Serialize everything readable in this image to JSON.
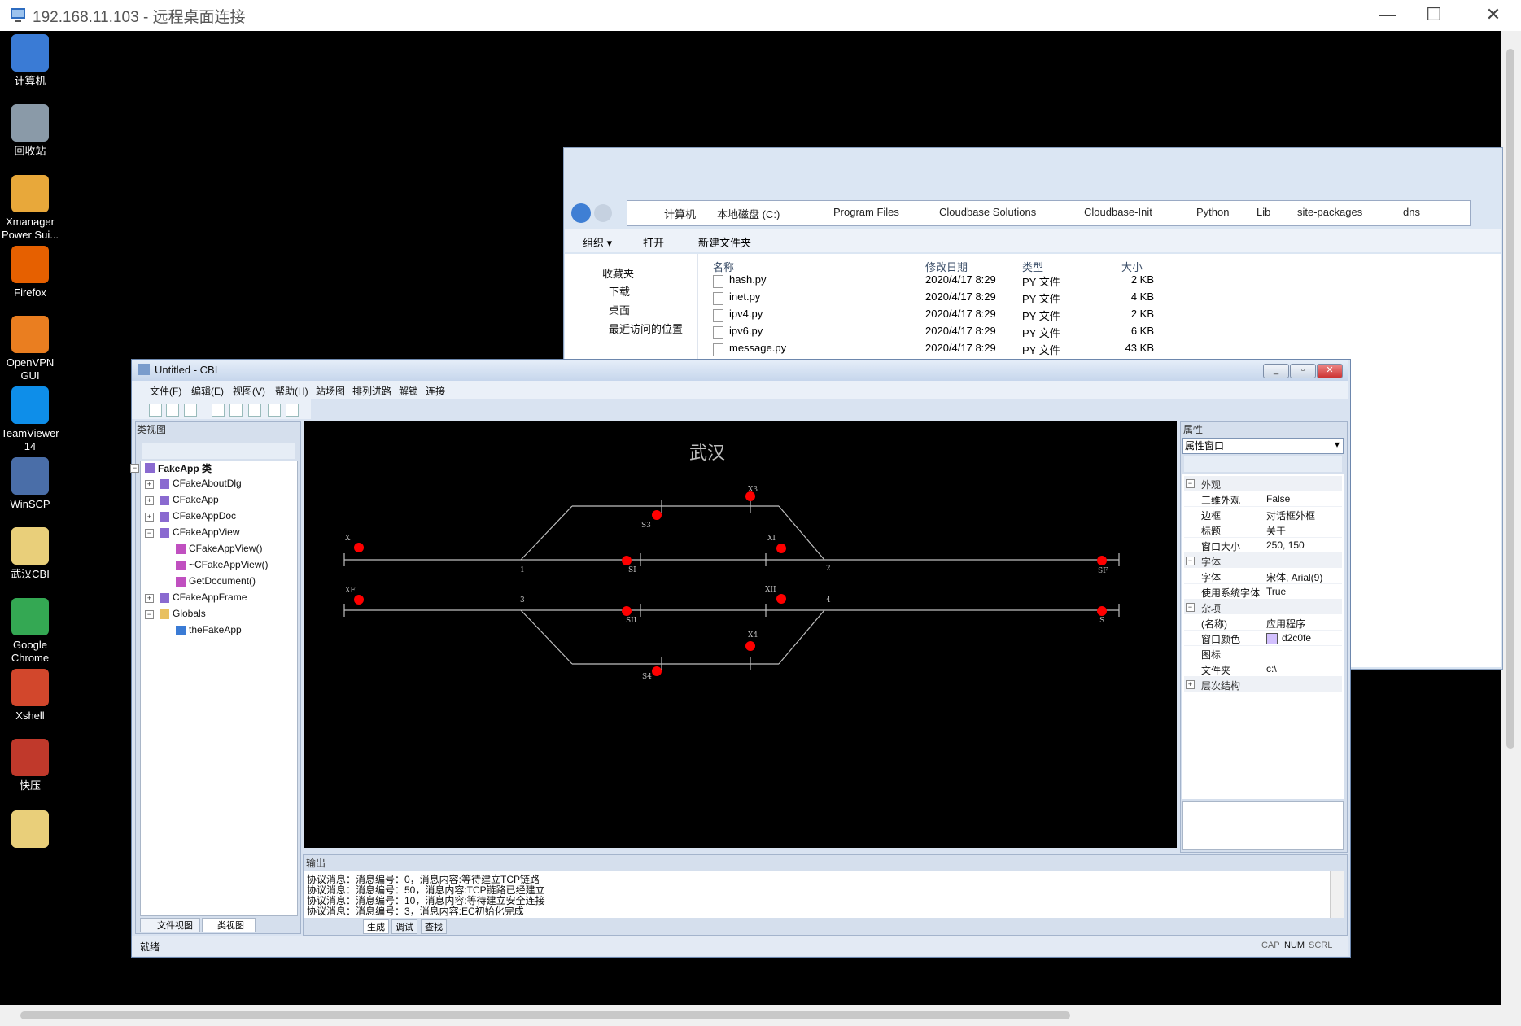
{
  "rdp": {
    "title": "192.168.11.103 - 远程桌面连接",
    "min": "—",
    "max": "☐",
    "close": "✕"
  },
  "desktop": {
    "icons": [
      {
        "label": "计算机",
        "color": "#3a7bd5"
      },
      {
        "label": "回收站",
        "color": "#8a9aa8"
      },
      {
        "label": "Xmanager Power Sui...",
        "color": "#e8a83a"
      },
      {
        "label": "Firefox",
        "color": "#e66000"
      },
      {
        "label": "OpenVPN GUI",
        "color": "#ea7e20"
      },
      {
        "label": "TeamViewer 14",
        "color": "#0e8ee9"
      },
      {
        "label": "WinSCP",
        "color": "#4a6ea8"
      },
      {
        "label": "武汉CBI",
        "color": "#e9cf7a"
      },
      {
        "label": "Google Chrome",
        "color": "#34a853"
      },
      {
        "label": "Xshell",
        "color": "#d2472c"
      },
      {
        "label": "快压",
        "color": "#c0392b"
      },
      {
        "label": "",
        "color": "#e9cf7a"
      }
    ]
  },
  "explorer": {
    "breadcrumb": [
      "计算机",
      "本地磁盘 (C:)",
      "Program Files",
      "Cloudbase Solutions",
      "Cloudbase-Init",
      "Python",
      "Lib",
      "site-packages",
      "dns"
    ],
    "toolbar": {
      "organize": "组织 ▾",
      "open": "打开",
      "new_folder": "新建文件夹"
    },
    "nav": [
      "收藏夹",
      "下载",
      "桌面",
      "最近访问的位置"
    ],
    "columns": {
      "name": "名称",
      "date": "修改日期",
      "type": "类型",
      "size": "大小"
    },
    "files": [
      {
        "name": "hash.py",
        "date": "2020/4/17 8:29",
        "type": "PY 文件",
        "size": "2 KB"
      },
      {
        "name": "inet.py",
        "date": "2020/4/17 8:29",
        "type": "PY 文件",
        "size": "4 KB"
      },
      {
        "name": "ipv4.py",
        "date": "2020/4/17 8:29",
        "type": "PY 文件",
        "size": "2 KB"
      },
      {
        "name": "ipv6.py",
        "date": "2020/4/17 8:29",
        "type": "PY 文件",
        "size": "6 KB"
      },
      {
        "name": "message.py",
        "date": "2020/4/17 8:29",
        "type": "PY 文件",
        "size": "43 KB"
      }
    ]
  },
  "cbi": {
    "title": "Untitled - CBI",
    "menu": [
      "文件(F)",
      "编辑(E)",
      "视图(V)",
      "帮助(H)",
      "站场图",
      "排列进路",
      "解锁",
      "连接"
    ],
    "class_view": {
      "title": "类视图",
      "root": "FakeApp 类",
      "items": [
        "CFakeAboutDlg",
        "CFakeApp",
        "CFakeAppDoc",
        "CFakeAppView",
        "CFakeAppView()",
        "~CFakeAppView()",
        "GetDocument()",
        "CFakeAppFrame",
        "Globals",
        "theFakeApp"
      ],
      "tabs": [
        "文件视图",
        "类视图"
      ]
    },
    "station": {
      "title": "武汉",
      "labels": {
        "X": "X",
        "XF": "XF",
        "S3": "S3",
        "X3": "X3",
        "XI": "XI",
        "XII": "XII",
        "SI": "SI",
        "SII": "SII",
        "X4": "X4",
        "S4": "S4",
        "SF": "SF",
        "S": "S",
        "n1": "1",
        "n2": "2",
        "n3": "3",
        "n4": "4"
      },
      "signal_color": "#ff0000",
      "track_color": "#bfbfbf"
    },
    "properties": {
      "title": "属性",
      "combo": "属性窗口",
      "sections": [
        {
          "name": "外观",
          "rows": [
            [
              "三维外观",
              "False"
            ],
            [
              "边框",
              "对话框外框"
            ],
            [
              "标题",
              "关于"
            ],
            [
              "窗口大小",
              "250, 150"
            ]
          ]
        },
        {
          "name": "字体",
          "rows": [
            [
              "字体",
              "宋体, Arial(9)"
            ],
            [
              "使用系统字体",
              "True"
            ]
          ]
        },
        {
          "name": "杂项",
          "rows": [
            [
              "(名称)",
              "应用程序"
            ],
            [
              "窗口颜色",
              "d2c0fe"
            ],
            [
              "图标",
              ""
            ],
            [
              "文件夹",
              "c:\\"
            ]
          ]
        },
        {
          "name": "层次结构",
          "rows": []
        }
      ],
      "swatch_color": "#d2c0fe"
    },
    "output": {
      "title": "输出",
      "lines": [
        "协议消息：消息编号：0，消息内容:等待建立TCP链路",
        "协议消息：消息编号：50，消息内容:TCP链路已经建立",
        "协议消息：消息编号：10，消息内容:等待建立安全连接",
        "协议消息：消息编号：3，消息内容:EC初始化完成"
      ],
      "tabs": [
        "生成",
        "调试",
        "查找"
      ]
    },
    "status": {
      "text": "就绪",
      "cap": "CAP",
      "num": "NUM",
      "scrl": "SCRL"
    }
  }
}
